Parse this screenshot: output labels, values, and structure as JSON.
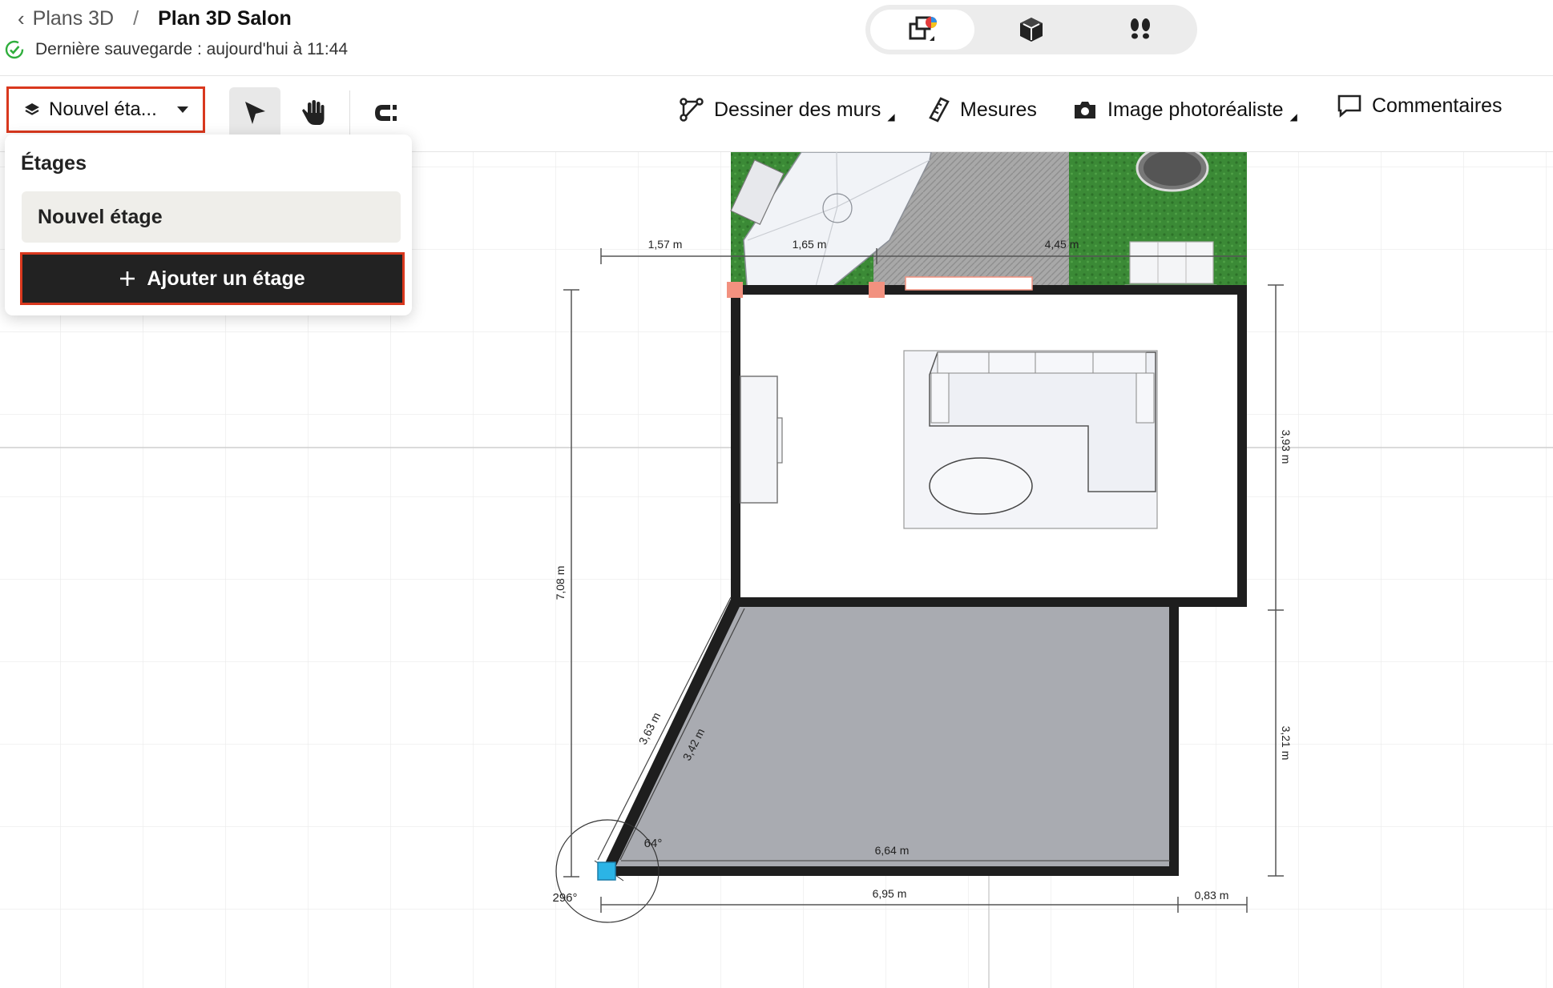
{
  "header": {
    "breadcrumb_parent": "Plans 3D",
    "breadcrumb_separator": "/",
    "breadcrumb_title": "Plan 3D Salon",
    "save_status": "Dernière sauvegarde : aujourd'hui à 11:44"
  },
  "view_modes": [
    {
      "icon": "2d-plan-icon",
      "active": true
    },
    {
      "icon": "3d-cube-icon",
      "active": false
    },
    {
      "icon": "footsteps-icon",
      "active": false
    }
  ],
  "toolbar": {
    "floor_selector_label": "Nouvel éta...",
    "tools": [
      {
        "icon": "select-arrow-icon",
        "active": true
      },
      {
        "icon": "hand-pan-icon",
        "active": false
      },
      {
        "icon": "magnet-icon",
        "active": false
      }
    ],
    "draw_walls": "Dessiner des murs",
    "measures": "Mesures",
    "photoreal": "Image photoréaliste",
    "comments": "Commentaires"
  },
  "floors_dropdown": {
    "heading": "Étages",
    "floors": [
      "Nouvel étage"
    ],
    "add_button": "Ajouter un étage"
  },
  "plan": {
    "dimensions": {
      "top_1": "1,57 m",
      "top_2": "1,65 m",
      "top_3": "4,45 m",
      "left_total": "7,08 m",
      "right_upper": "3,93 m",
      "right_lower": "3,21 m",
      "diag_outer": "3,63 m",
      "diag_inner": "3,42 m",
      "bottom_inner": "6,64 m",
      "bottom_outer": "6,95 m",
      "bottom_right": "0,83 m",
      "angle_inner": "64°",
      "angle_outer": "296°"
    },
    "colors": {
      "wall": "#1e1e1e",
      "floor_gray": "#a9abb1",
      "grass": "#3f8f3a",
      "paving": "#a6a6a6",
      "selected_handle": "#2bb4e6",
      "marker": "#f2917f"
    }
  }
}
